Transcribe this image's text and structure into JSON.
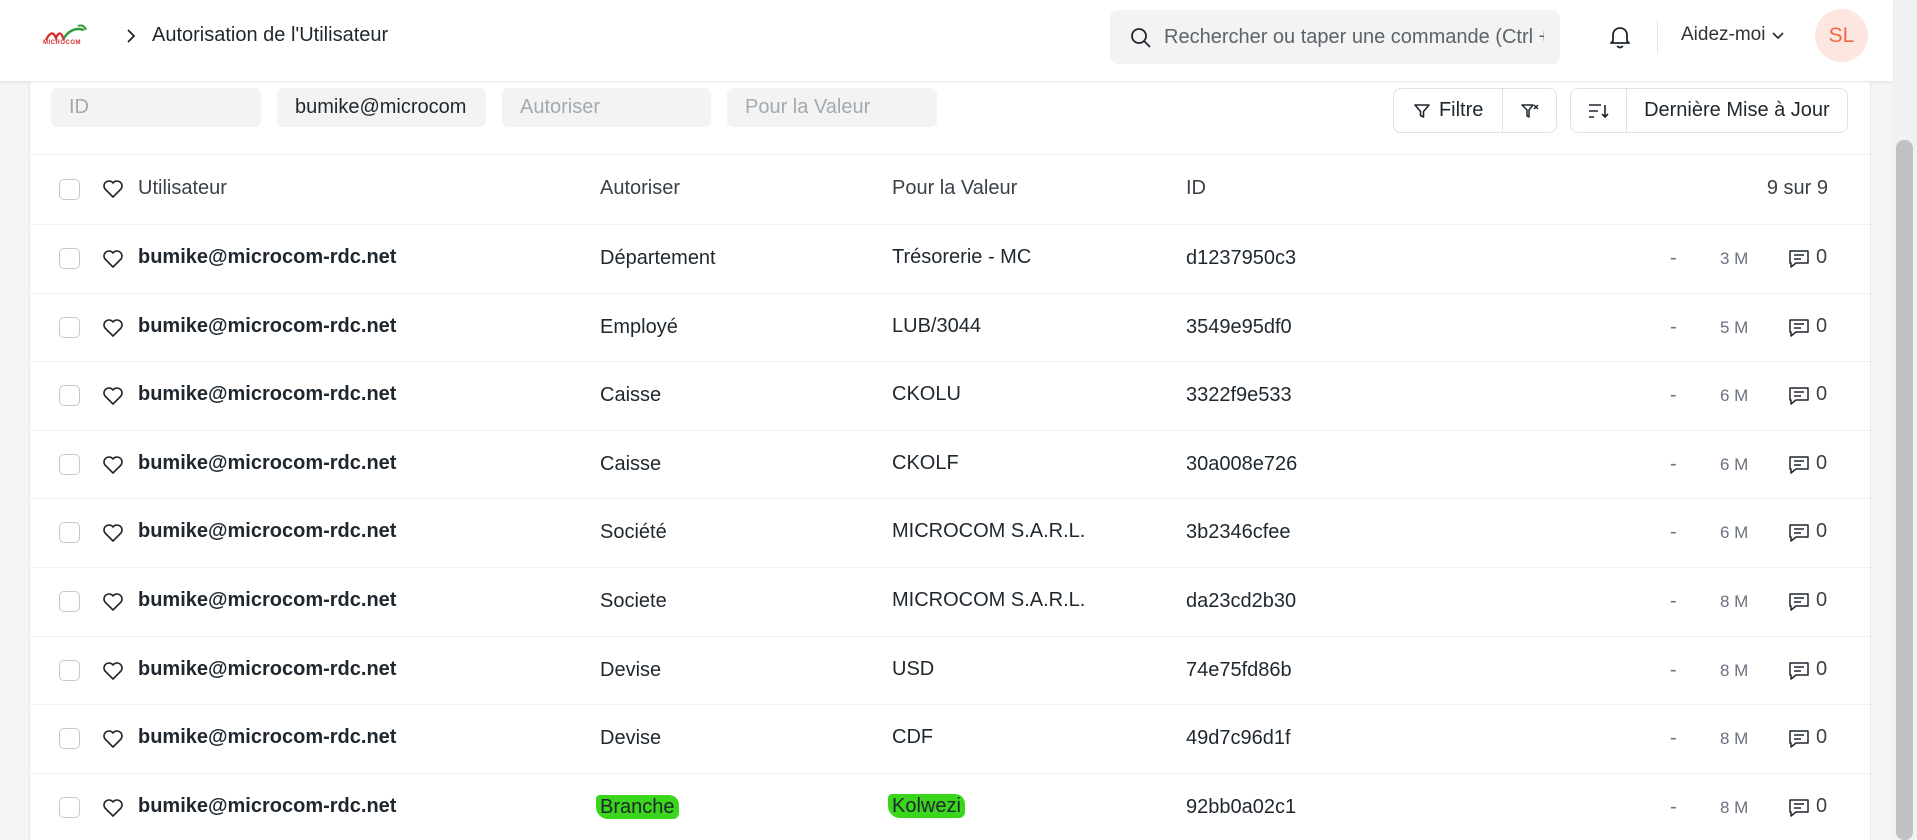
{
  "navbar": {
    "logo_text": "MICROCOM",
    "breadcrumb": "Autorisation de l'Utilisateur",
    "search_placeholder": "Rechercher ou taper une commande (Ctrl + G)",
    "help_label": "Aidez-moi",
    "avatar_initials": "SL"
  },
  "filters": {
    "id_placeholder": "ID",
    "user_value": "bumike@microcom",
    "allow_placeholder": "Autoriser",
    "for_value_placeholder": "Pour la Valeur",
    "filter_label": "Filtre",
    "sort_label": "Dernière Mise à Jour"
  },
  "table": {
    "headers": {
      "user": "Utilisateur",
      "allow": "Autoriser",
      "for_value": "Pour la Valeur",
      "id": "ID",
      "count": "9 sur 9"
    },
    "rows": [
      {
        "user": "bumike@microcom-rdc.net",
        "allow": "Département",
        "for_value": "Trésorerie - MC",
        "id": "d1237950c3",
        "dash": "-",
        "ago": "3 M",
        "comments": "0"
      },
      {
        "user": "bumike@microcom-rdc.net",
        "allow": "Employé",
        "for_value": "LUB/3044",
        "id": "3549e95df0",
        "dash": "-",
        "ago": "5 M",
        "comments": "0"
      },
      {
        "user": "bumike@microcom-rdc.net",
        "allow": "Caisse",
        "for_value": "CKOLU",
        "id": "3322f9e533",
        "dash": "-",
        "ago": "6 M",
        "comments": "0"
      },
      {
        "user": "bumike@microcom-rdc.net",
        "allow": "Caisse",
        "for_value": "CKOLF",
        "id": "30a008e726",
        "dash": "-",
        "ago": "6 M",
        "comments": "0"
      },
      {
        "user": "bumike@microcom-rdc.net",
        "allow": "Société",
        "for_value": "MICROCOM S.A.R.L.",
        "id": "3b2346cfee",
        "dash": "-",
        "ago": "6 M",
        "comments": "0"
      },
      {
        "user": "bumike@microcom-rdc.net",
        "allow": "Societe",
        "for_value": "MICROCOM S.A.R.L.",
        "id": "da23cd2b30",
        "dash": "-",
        "ago": "8 M",
        "comments": "0"
      },
      {
        "user": "bumike@microcom-rdc.net",
        "allow": "Devise",
        "for_value": "USD",
        "id": "74e75fd86b",
        "dash": "-",
        "ago": "8 M",
        "comments": "0"
      },
      {
        "user": "bumike@microcom-rdc.net",
        "allow": "Devise",
        "for_value": "CDF",
        "id": "49d7c96d1f",
        "dash": "-",
        "ago": "8 M",
        "comments": "0"
      },
      {
        "user": "bumike@microcom-rdc.net",
        "allow": "Branche",
        "for_value": "Kolwezi",
        "id": "92bb0a02c1",
        "dash": "-",
        "ago": "8 M",
        "comments": "0",
        "highlight": true
      }
    ]
  },
  "colors": {
    "highlight": "#39d61c",
    "avatar_bg": "#fde6df",
    "avatar_fg": "#ec6a45"
  }
}
